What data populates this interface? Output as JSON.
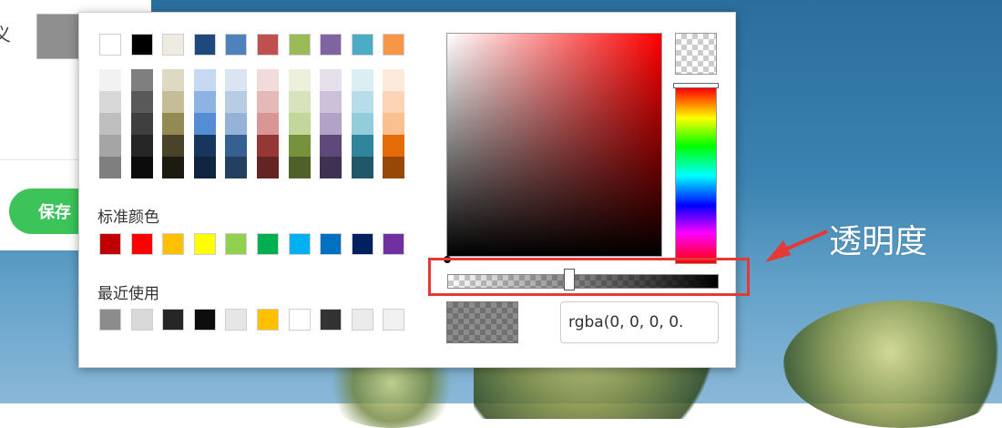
{
  "background_panel": {
    "label": "义",
    "current_swatch_color": "#8f8f8f",
    "save_button_label": "保存"
  },
  "palette": {
    "theme_row": [
      "#ffffff",
      "#000000",
      "#eeece1",
      "#1f497d",
      "#4f81bd",
      "#c0504d",
      "#9bbb59",
      "#8064a2",
      "#4bacc6",
      "#f79646"
    ],
    "shade_columns": [
      [
        "#f2f2f2",
        "#d8d8d8",
        "#bfbfbf",
        "#a5a5a5",
        "#7f7f7f"
      ],
      [
        "#7f7f7f",
        "#595959",
        "#3f3f3f",
        "#262626",
        "#0c0c0c"
      ],
      [
        "#ddd9c3",
        "#c4bd97",
        "#938953",
        "#494429",
        "#1d1b10"
      ],
      [
        "#c6d9f0",
        "#8db3e2",
        "#548dd4",
        "#17365d",
        "#0f243e"
      ],
      [
        "#dbe5f1",
        "#b8cce4",
        "#95b3d7",
        "#366092",
        "#244061"
      ],
      [
        "#f2dcdb",
        "#e5b9b7",
        "#d99694",
        "#953734",
        "#632423"
      ],
      [
        "#ebf1dd",
        "#d7e3bc",
        "#c3d69b",
        "#76923c",
        "#4f6128"
      ],
      [
        "#e5e0ec",
        "#ccc1d9",
        "#b2a2c7",
        "#5f497a",
        "#3f3151"
      ],
      [
        "#dbeef3",
        "#b7dde8",
        "#92cddc",
        "#31859b",
        "#205867"
      ],
      [
        "#fdeada",
        "#fbd5b5",
        "#fac08f",
        "#e36c09",
        "#974806"
      ]
    ],
    "standard_title": "标准颜色",
    "standard_colors": [
      "#c00000",
      "#ff0000",
      "#ffc000",
      "#ffff00",
      "#92d050",
      "#00b050",
      "#00b0f0",
      "#0070c0",
      "#002060",
      "#7030a0"
    ],
    "recent_title": "最近使用",
    "recent_colors": [
      "#8c8c8c",
      "#d9d9d9",
      "#262626",
      "#0d0d0d",
      "#e6e6e6",
      "#ffc000",
      "#ffffff",
      "#333333",
      "#ebebeb",
      "#f0f0f0"
    ]
  },
  "picker": {
    "hue_color": "#ff0000",
    "alpha_value": 0.45,
    "value_text": "rgba(0, 0, 0, 0.",
    "value_placeholder": ""
  },
  "annotation": {
    "text": "透明度",
    "highlight_color": "#e53935"
  }
}
